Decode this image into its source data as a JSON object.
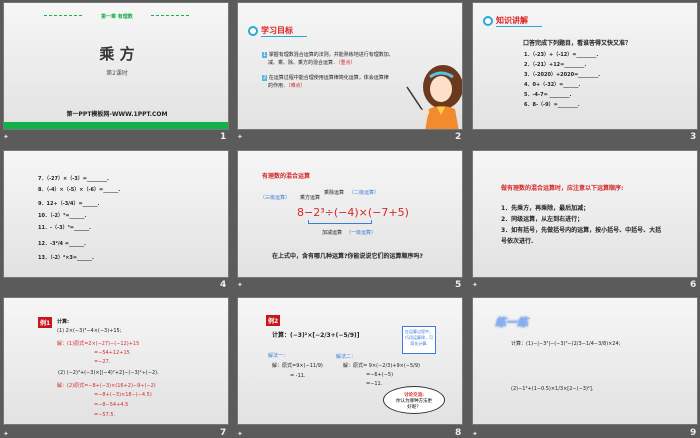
{
  "slides": [
    {
      "number": "1",
      "header": "第一章 有理数",
      "title": "乘 方",
      "subtitle": "第2课时",
      "footer": "第一PPT模板网-WWW.1PPT.COM"
    },
    {
      "number": "2",
      "heading": "学习目标",
      "items": [
        {
          "n": "1",
          "text": "掌握有理数混合运算的法则，并能熟练地进行有理数加、",
          "text2": "减、乘、除、乘方的混合运算．",
          "tag": "（重点）"
        },
        {
          "n": "2",
          "text": "在运算过程中能合理使用运算律简化运算，体会运算律",
          "text2": "的作用．",
          "tag": "（难点）"
        }
      ]
    },
    {
      "number": "3",
      "heading": "知识讲解",
      "prompt": "口答完成下列题目，看谁答得又快又准？",
      "items": [
        "1．（-23）+（-12）=________.",
        "2．（-21）+12=________.",
        "3．（-2020）+2020=________.",
        "4．0+（-32）=______.",
        "5．-4-7= ________.",
        "6．8-（-9）=________."
      ]
    },
    {
      "number": "4",
      "items": [
        "7．（-27）×（-3）=________.",
        "8．（-4）×（-5）×（-6）=______.",
        "9．12÷（-3/4）=______.",
        "10．（-2）³=______.",
        "11．-（-3）³=______.",
        "12．-3²/4 =______.",
        "13．（-2）²×3=______."
      ]
    },
    {
      "number": "5",
      "heading": "有理数的混合运算",
      "expr": "8−2³÷(−4)×(−7+5)",
      "labels": {
        "level3": "（三级运算）",
        "power": "乘方运算",
        "muldiv": "乘除运算",
        "level2": "（二级运算）",
        "addsub": "加减运算",
        "level1": "（一级运算）"
      },
      "question": "在上式中，含有哪几种运算?你能说说它们的运算顺序吗?"
    },
    {
      "number": "6",
      "heading": "做有理数的混合运算时，应注意以下运算顺序:",
      "items": [
        "1．先乘方，再乘除，最后加减；",
        "2．同级运算，从左到右进行；",
        "3．如有括号，先做括号内的运算，按小括号、中括号、大括",
        "号依次进行."
      ]
    },
    {
      "number": "7",
      "badge": "例1",
      "calc": "计算:",
      "q1": "(1) 2×(−3)³−4×(−3)+15;",
      "s1": [
        "解：(1)原式=2×(−27)−(−12)+15",
        "=−54+12+15",
        "=−27."
      ],
      "q2": "(2) (−2)³+(−3)×[(−4)²+2]−(−3)²÷(−2).",
      "s2": [
        "解：(2)原式=−8+(−3)×(16+2)−9÷(−2)",
        "=−8+(−3)×18−(−4.5)",
        "=−8−54+4.5",
        "=−57.5."
      ]
    },
    {
      "number": "8",
      "badge": "例2",
      "calc": "计算：(−3)²×[−2/3+(−5/9)]",
      "m1": "解法一：",
      "m1s": [
        "解：原式=9×(−11/9)",
        "= -11."
      ],
      "m2": "解法二：",
      "m2s": [
        "解：原式= 9×(−2/3)+9×(−5/9)",
        "=−6+(−5)",
        "=−11."
      ],
      "callout": "在运算过程中，巧用运算律，可简化计算.",
      "thought_title": "讨论交流:",
      "thought": "你认为哪种方法更好呢？"
    },
    {
      "number": "9",
      "heading": "练一练",
      "q1": "计算：(1)−|−3²|−(−3)³−(2/3−1/4−3/8)×24;",
      "q2": "(2)−1⁴+(1−0.5)×1/3×[2−(−3)²]."
    }
  ],
  "colors": {
    "accent_green": "#12b04a",
    "accent_red": "#d42a2a",
    "accent_blue": "#2aa9d8",
    "background": "#5b5b5b"
  }
}
